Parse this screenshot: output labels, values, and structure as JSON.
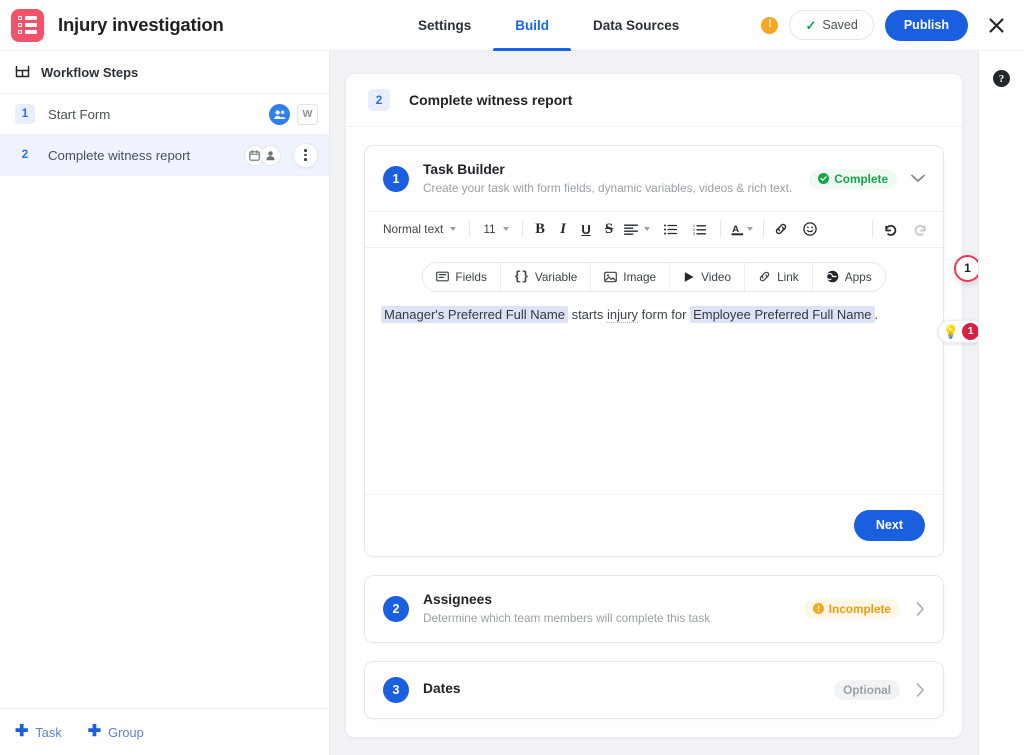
{
  "header": {
    "app_title": "Injury investigation",
    "logo_icon": "checklist-icon",
    "nav": [
      {
        "label": "Settings",
        "active": false
      },
      {
        "label": "Build",
        "active": true
      },
      {
        "label": "Data Sources",
        "active": false
      }
    ],
    "warning_icon": "warning-exclamation-icon",
    "saved_label": "Saved",
    "saved_icon": "check-icon",
    "publish_label": "Publish",
    "close_icon": "close-x-icon",
    "accent_blue": "#1a5fe0",
    "brand_red": "#f2536a"
  },
  "sidebar": {
    "section_title": "Workflow Steps",
    "section_icon": "workflow-icon",
    "steps": [
      {
        "number": "1",
        "label": "Start Form",
        "selected": false,
        "icons": [
          "people-avatar-icon",
          "w-badge"
        ],
        "badge_text": "W"
      },
      {
        "number": "2",
        "label": "Complete witness report",
        "selected": true,
        "icons": [
          "calendar-icon",
          "person-icon",
          "kebab-menu-icon"
        ]
      }
    ],
    "footer": [
      {
        "label": "Task",
        "icon": "plus-icon"
      },
      {
        "label": "Group",
        "icon": "plus-icon"
      }
    ]
  },
  "main": {
    "panel": {
      "number": "2",
      "title": "Complete witness report"
    },
    "cards": [
      {
        "number": "1",
        "title": "Task Builder",
        "subtitle": "Create your task with form fields, dynamic variables, videos & rich text.",
        "status_label": "Complete",
        "status_type": "complete",
        "status_icon": "check-circle-icon",
        "chevron": "chevron-down-icon"
      },
      {
        "number": "2",
        "title": "Assignees",
        "subtitle": "Determine which team members will complete this task",
        "status_label": "Incomplete",
        "status_type": "incomplete",
        "status_icon": "alert-circle-icon",
        "chevron": "chevron-right-icon"
      },
      {
        "number": "3",
        "title": "Dates",
        "subtitle": "",
        "status_label": "Optional",
        "status_type": "optional",
        "status_icon": "",
        "chevron": "chevron-right-icon"
      }
    ],
    "editor": {
      "toolbar": {
        "style_value": "Normal text",
        "font_size_value": "11",
        "buttons": [
          {
            "name": "bold",
            "glyph": "B"
          },
          {
            "name": "italic",
            "glyph": "I"
          },
          {
            "name": "underline",
            "glyph": "U"
          },
          {
            "name": "strikethrough",
            "glyph": "S"
          }
        ],
        "align_icon": "align-left-icon",
        "bullet_list_icon": "bullet-list-icon",
        "numbered_list_icon": "numbered-list-icon",
        "text_color_icon": "text-color-icon",
        "link_icon": "link-icon",
        "emoji_icon": "emoji-icon",
        "undo_icon": "undo-icon",
        "redo_icon": "redo-icon"
      },
      "insert_buttons": [
        {
          "label": "Fields",
          "icon": "fields-icon"
        },
        {
          "label": "Variable",
          "icon": "variable-braces-icon"
        },
        {
          "label": "Image",
          "icon": "image-icon"
        },
        {
          "label": "Video",
          "icon": "video-play-icon"
        },
        {
          "label": "Link",
          "icon": "link-icon"
        },
        {
          "label": "Apps",
          "icon": "apps-icon"
        }
      ],
      "content": {
        "chip1": "Manager's Preferred Full Name",
        "mid_before": " starts ",
        "misspelled": "injury",
        "mid_after": " form for ",
        "chip2": "Employee Preferred Full Name",
        "trailing": "."
      },
      "annotation_number": "1",
      "hint_icon": "lightbulb-icon",
      "hint_count": "1",
      "next_label": "Next"
    }
  },
  "right_rail": {
    "help_icon": "help-question-icon",
    "help_glyph": "?"
  }
}
